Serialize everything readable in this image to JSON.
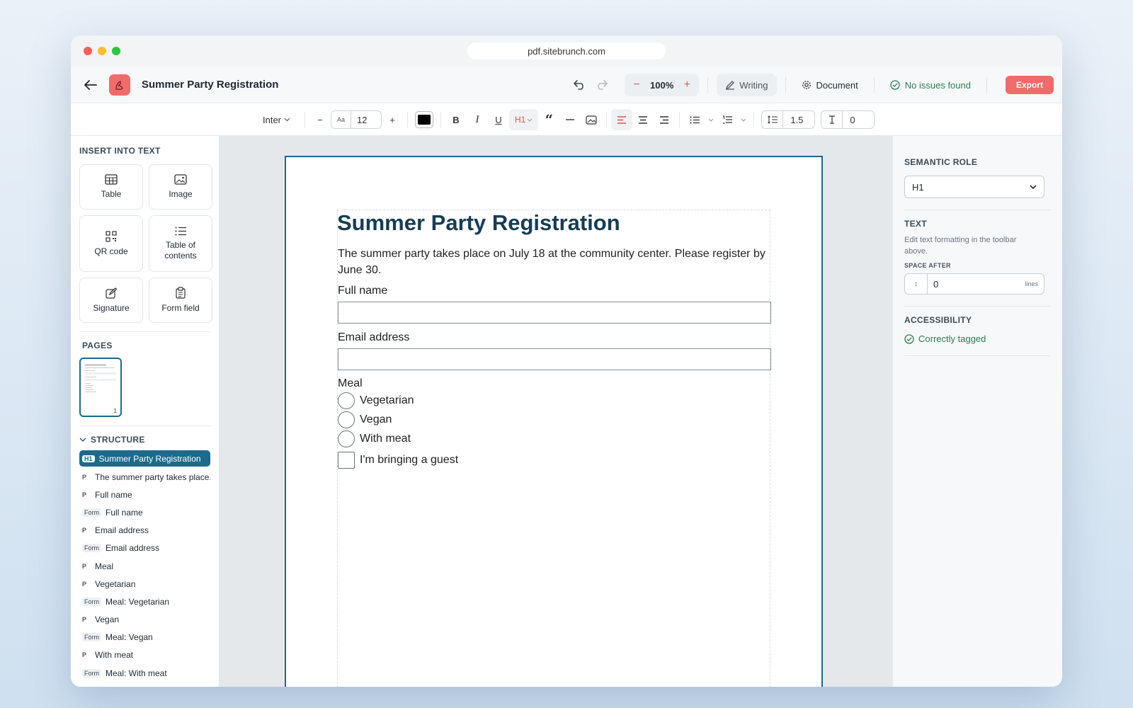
{
  "browser": {
    "url": "pdf.sitebrunch.com"
  },
  "header": {
    "title": "Summer Party Registration",
    "zoom": "100%",
    "mode_label": "Writing",
    "document_label": "Document",
    "issues_label": "No issues found",
    "export_label": "Export"
  },
  "toolbar": {
    "font": "Inter",
    "size_prefix": "Aa",
    "font_size": "12",
    "heading": "H1",
    "line_spacing": "1.5",
    "indent": "0",
    "text_color": "#000000"
  },
  "left": {
    "insert_title": "INSERT INTO TEXT",
    "insert_items": [
      "Table",
      "Image",
      "QR code",
      "Table of contents",
      "Signature",
      "Form field"
    ],
    "pages_title": "PAGES",
    "page_number": "1",
    "structure_title": "STRUCTURE",
    "structure": [
      {
        "tag": "H1",
        "label": "Summer Party Registration"
      },
      {
        "tag": "P",
        "label": "The summer party takes place..."
      },
      {
        "tag": "P",
        "label": "Full name"
      },
      {
        "tag": "Form",
        "label": "Full name"
      },
      {
        "tag": "P",
        "label": "Email address"
      },
      {
        "tag": "Form",
        "label": "Email address"
      },
      {
        "tag": "P",
        "label": "Meal"
      },
      {
        "tag": "P",
        "label": "Vegetarian"
      },
      {
        "tag": "Form",
        "label": "Meal: Vegetarian"
      },
      {
        "tag": "P",
        "label": "Vegan"
      },
      {
        "tag": "Form",
        "label": "Meal: Vegan"
      },
      {
        "tag": "P",
        "label": "With meat"
      },
      {
        "tag": "Form",
        "label": "Meal: With meat"
      }
    ]
  },
  "document": {
    "heading": "Summer Party Registration",
    "intro": "The summer party takes place on July 18 at the community center. Please register by June 30.",
    "fullname_label": "Full name",
    "email_label": "Email address",
    "meal_label": "Meal",
    "meal_options": [
      "Vegetarian",
      "Vegan",
      "With meat"
    ],
    "guest_label": "I'm bringing a guest"
  },
  "right": {
    "semantic_title": "SEMANTIC ROLE",
    "role_value": "H1",
    "text_title": "TEXT",
    "text_help": "Edit text formatting in the toolbar above.",
    "space_after_title": "SPACE AFTER",
    "space_after_value": "0",
    "space_after_unit": "lines",
    "accessibility_title": "ACCESSIBILITY",
    "accessibility_status": "Correctly tagged"
  },
  "colors": {
    "accent": "#1d6a8a",
    "brand": "#f26b6b",
    "success": "#2e7d4f"
  }
}
